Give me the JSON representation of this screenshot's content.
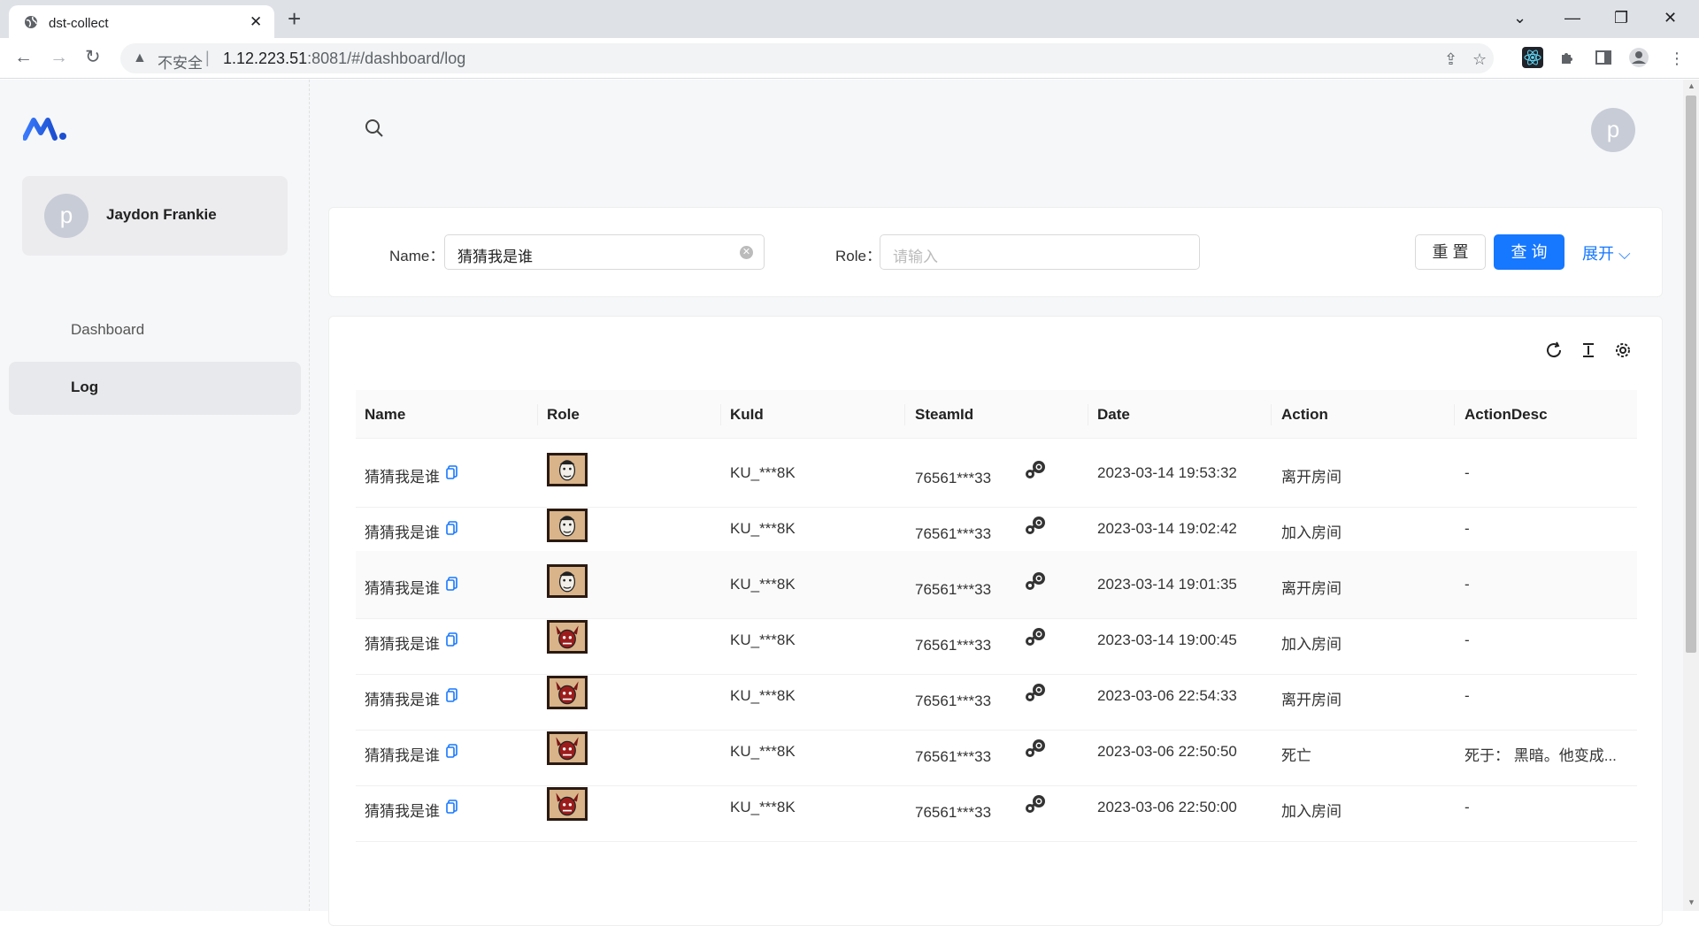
{
  "browser": {
    "tab_title": "dst-collect",
    "insecure_label": "不安全",
    "url_host": "1.12.223.51",
    "url_rest": ":8081/#/dashboard/log"
  },
  "sidebar": {
    "user_name": "Jaydon Frankie",
    "avatar_letter": "p",
    "items": [
      {
        "label": "Dashboard"
      },
      {
        "label": "Log"
      }
    ]
  },
  "header": {
    "avatar_letter": "p"
  },
  "filter": {
    "name_label": "Name",
    "name_value": "猜猜我是谁",
    "role_label": "Role",
    "role_placeholder": "请输入",
    "reset_label": "重 置",
    "query_label": "查 询",
    "expand_label": "展开"
  },
  "table": {
    "columns": [
      "Name",
      "Role",
      "KuId",
      "SteamId",
      "Date",
      "Action",
      "ActionDesc"
    ],
    "rows": [
      {
        "name": "猜猜我是谁",
        "role": "maxwell",
        "kuid": "KU_***8K",
        "steamid": "76561***33",
        "date": "2023-03-14 19:53:32",
        "action": "离开房间",
        "desc": "-"
      },
      {
        "name": "猜猜我是谁",
        "role": "maxwell",
        "kuid": "KU_***8K",
        "steamid": "76561***33",
        "date": "2023-03-14 19:02:42",
        "action": "加入房间",
        "desc": "-"
      },
      {
        "name": "猜猜我是谁",
        "role": "maxwell",
        "kuid": "KU_***8K",
        "steamid": "76561***33",
        "date": "2023-03-14 19:01:35",
        "action": "离开房间",
        "desc": "-"
      },
      {
        "name": "猜猜我是谁",
        "role": "wortox",
        "kuid": "KU_***8K",
        "steamid": "76561***33",
        "date": "2023-03-14 19:00:45",
        "action": "加入房间",
        "desc": "-"
      },
      {
        "name": "猜猜我是谁",
        "role": "wortox",
        "kuid": "KU_***8K",
        "steamid": "76561***33",
        "date": "2023-03-06 22:54:33",
        "action": "离开房间",
        "desc": "-"
      },
      {
        "name": "猜猜我是谁",
        "role": "wortox",
        "kuid": "KU_***8K",
        "steamid": "76561***33",
        "date": "2023-03-06 22:50:50",
        "action": "死亡",
        "desc": "死于： 黑暗。他变成..."
      },
      {
        "name": "猜猜我是谁",
        "role": "wortox",
        "kuid": "KU_***8K",
        "steamid": "76561***33",
        "date": "2023-03-06 22:50:00",
        "action": "加入房间",
        "desc": "-"
      }
    ]
  },
  "colors": {
    "primary": "#1677ff",
    "sidebar_bg": "#f6f7f9"
  }
}
